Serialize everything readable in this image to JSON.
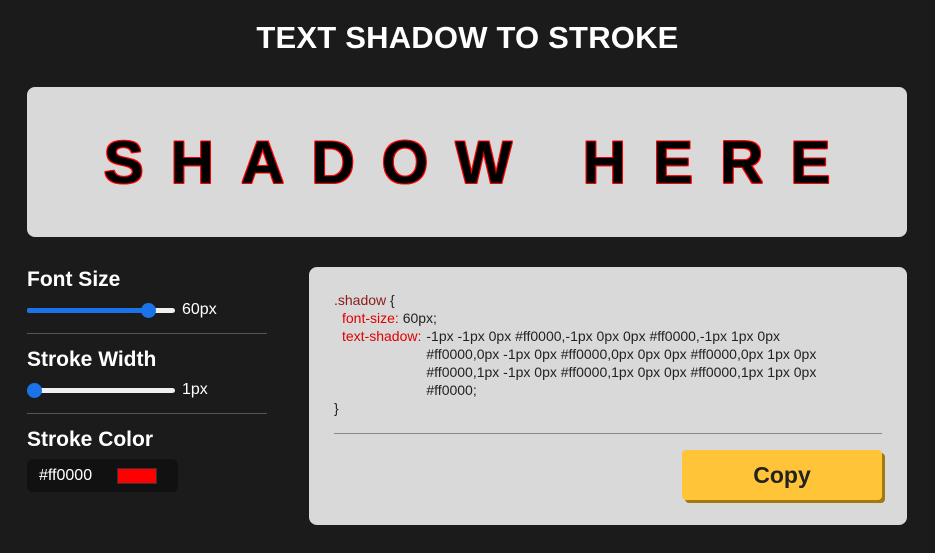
{
  "title": "TEXT SHADOW TO STROKE",
  "preview": {
    "text": "SHADOW HERE"
  },
  "controls": {
    "font_size": {
      "label": "Font Size",
      "value_label": "60px",
      "fraction": 0.85
    },
    "stroke_width": {
      "label": "Stroke Width",
      "value_label": "1px",
      "fraction": 0.0
    },
    "stroke_color": {
      "label": "Stroke Color",
      "hex": "#ff0000",
      "swatch_color": "#ff0000"
    }
  },
  "code": {
    "selector": ".shadow",
    "open_brace": " {",
    "font_size_prop": "font-size:",
    "font_size_value": " 60px;",
    "text_shadow_prop": "text-shadow:",
    "text_shadow_value": "-1px -1px 0px #ff0000,-1px 0px 0px #ff0000,-1px 1px 0px #ff0000,0px -1px 0px #ff0000,0px 0px 0px #ff0000,0px 1px 0px #ff0000,1px -1px 0px #ff0000,1px 0px 0px #ff0000,1px 1px 0px #ff0000;",
    "close_brace": "}"
  },
  "copy_button": {
    "label": "Copy"
  },
  "colors": {
    "background": "#1b1b1b",
    "panel": "#d9d9d9",
    "accent_blue": "#1a73e8",
    "copy_yellow": "#ffc437",
    "stroke_red": "#ff0000"
  }
}
